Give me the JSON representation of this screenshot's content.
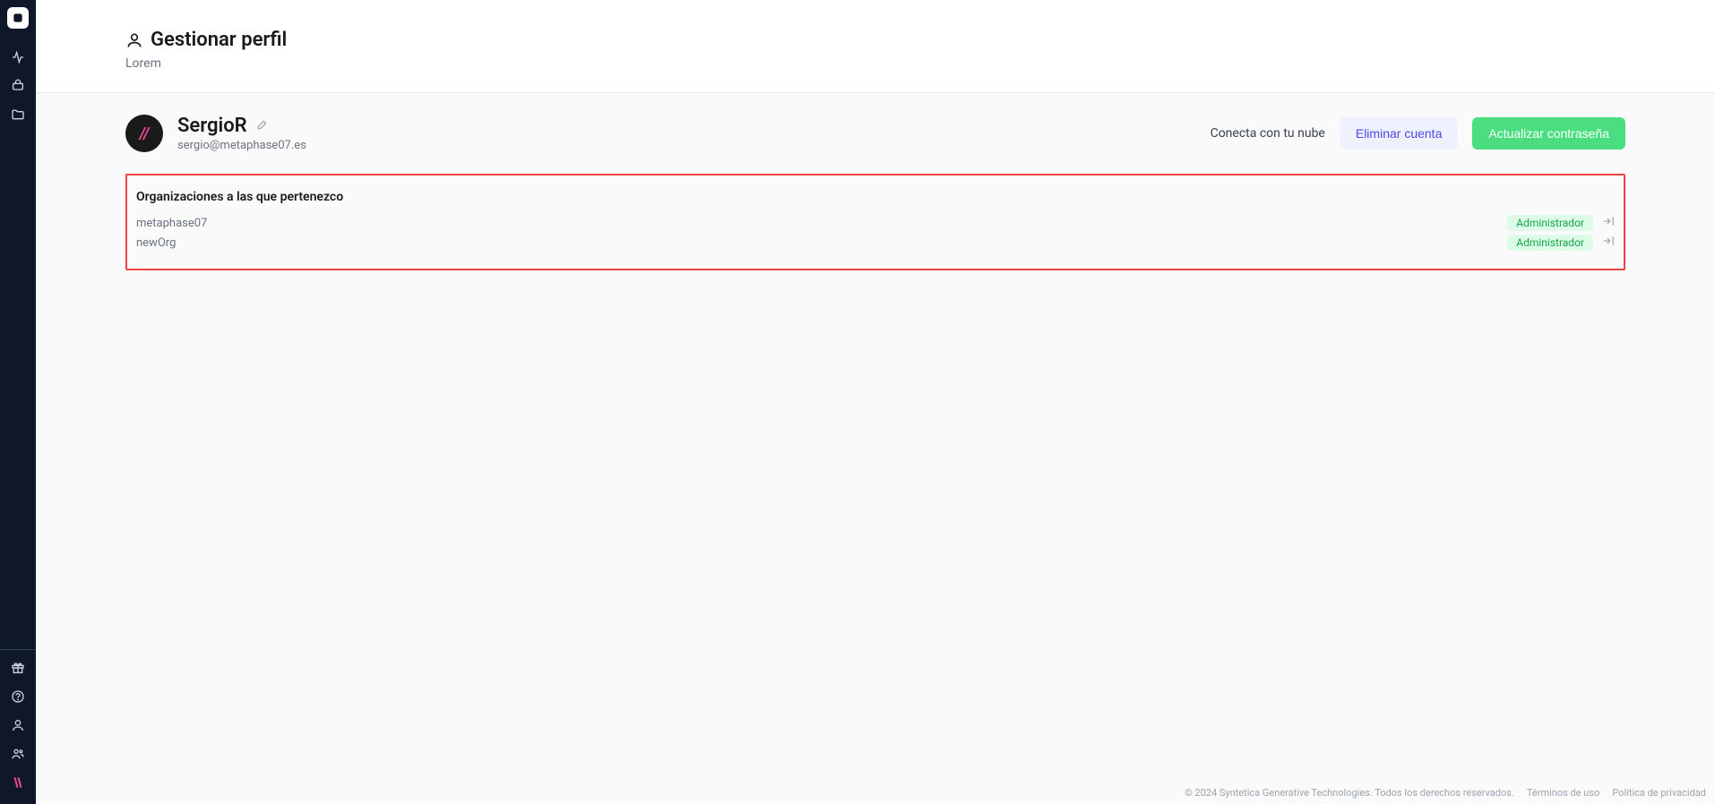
{
  "header": {
    "title": "Gestionar perfil",
    "subtitle": "Lorem"
  },
  "profile": {
    "name": "SergioR",
    "email": "sergio@metaphase07.es"
  },
  "actions": {
    "connect_cloud": "Conecta con tu nube",
    "delete_account": "Eliminar cuenta",
    "update_password": "Actualizar contraseña"
  },
  "organizations": {
    "title": "Organizaciones a las que pertenezco",
    "items": [
      {
        "name": "metaphase07",
        "role": "Administrador"
      },
      {
        "name": "newOrg",
        "role": "Administrador"
      }
    ]
  },
  "footer": {
    "copyright": "© 2024 Syntetica Generative Technologies. Todos los derechos reservados.",
    "terms": "Términos de uso",
    "privacy": "Política de privacidad"
  }
}
